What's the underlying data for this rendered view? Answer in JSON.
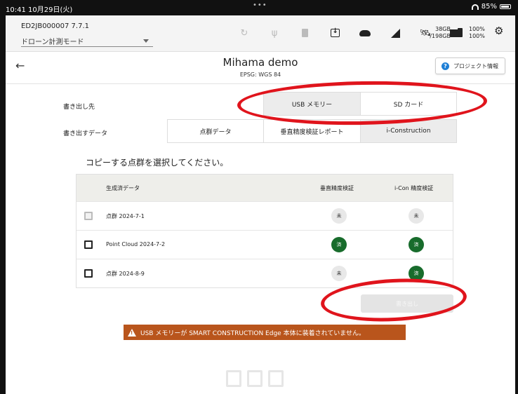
{
  "status_bar": {
    "time": "10:41 10月29日(火)",
    "battery": "85%"
  },
  "device": {
    "id_version": "ED2JB000007 7.7.1",
    "mode": "ドローン計測モード"
  },
  "storage": {
    "used": "38GB",
    "total": "/198GB"
  },
  "battery_levels": {
    "first": "100%",
    "second": "100%"
  },
  "project": {
    "title": "Mihama demo",
    "crs": "EPSG: WGS 84",
    "info_button": "プロジェクト情報"
  },
  "export_destination": {
    "label": "書き出し先",
    "options": [
      "USB メモリー",
      "SD カード"
    ],
    "selected": "USB メモリー"
  },
  "export_data": {
    "label": "書き出すデータ",
    "options": [
      "点群データ",
      "垂直精度検証レポート",
      "i-Construction"
    ],
    "selected": "i-Construction"
  },
  "instruction": "コピーする点群を選択してください。",
  "table": {
    "headers": [
      "生成済データ",
      "垂直精度検証",
      "i-Con 精度検証"
    ],
    "rows": [
      {
        "name": "点群 2024-7-1",
        "vertical": "未",
        "icon": "未",
        "enabled": false
      },
      {
        "name": "Point Cloud 2024-7-2",
        "vertical": "済",
        "icon": "済",
        "enabled": true
      },
      {
        "name": "点群 2024-8-9",
        "vertical": "未",
        "icon": "済",
        "enabled": true
      }
    ]
  },
  "export_button": "書き出し",
  "warning": "USB メモリーが SMART CONSTRUCTION Edge 本体に装着されていません。",
  "icons": [
    "back-arrow-icon",
    "sync-icon",
    "usb-icon",
    "sd-card-icon",
    "download-icon",
    "cloud-icon",
    "signal-icon",
    "satellite-icon",
    "folder-icon",
    "battery-icon",
    "gear-icon",
    "question-icon",
    "warning-icon"
  ],
  "colors": {
    "done_badge": "#186c2c",
    "warning_bg": "#b9551c",
    "annotation": "#e0141c",
    "info_icon": "#1e7fd6"
  }
}
